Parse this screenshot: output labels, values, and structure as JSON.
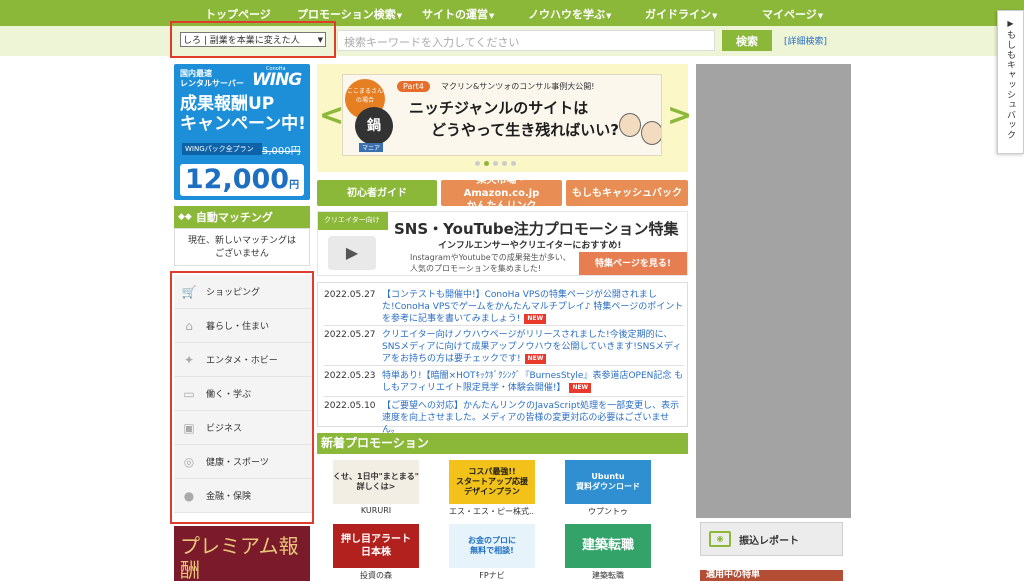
{
  "nav": {
    "items": [
      "トップページ",
      "プロモーション検索",
      "サイトの運営",
      "ノウハウを学ぶ",
      "ガイドライン",
      "マイページ"
    ],
    "dropdown_flags": [
      false,
      true,
      true,
      true,
      true,
      true
    ]
  },
  "search": {
    "site_select": "しろ | 副業を本業に変えた人",
    "placeholder": "検索キーワードを入力してください",
    "button": "検索",
    "advanced": "[詳細検索]"
  },
  "side_tab": {
    "label": "もしもキャッシュバック"
  },
  "left": {
    "wing": {
      "line1": "国内最速",
      "line2": "レンタルサーバー",
      "brand_small": "ConoHa",
      "brand": "WING",
      "head1": "成果報酬UP",
      "head2": "キャンペーン中!",
      "plan": "WINGパック全プラン",
      "old_price": "5,000円",
      "price": "12,000",
      "price_unit": "円"
    },
    "auto_matching": {
      "title": "自動マッチング",
      "body1": "現在、新しいマッチングは",
      "body2": "ございません"
    },
    "categories": [
      {
        "label": "ショッピング",
        "icon": "cart-icon"
      },
      {
        "label": "暮らし・住まい",
        "icon": "house-icon"
      },
      {
        "label": "エンタメ・ホビー",
        "icon": "game-icon"
      },
      {
        "label": "働く・学ぶ",
        "icon": "desk-icon"
      },
      {
        "label": "ビジネス",
        "icon": "briefcase-icon"
      },
      {
        "label": "健康・スポーツ",
        "icon": "pin-icon"
      },
      {
        "label": "金融・保険",
        "icon": "piggybank-icon"
      }
    ],
    "premium": "プレミアム報酬"
  },
  "carousel": {
    "badge": "ここまるさんの場合",
    "part": "Part4",
    "sub": "マクリン&サンツォのコンサル事例大公開!",
    "title1": "ニッチジャンルのサイトは",
    "title2": "どうやって生き残ればいい?",
    "pot_label": "鍋",
    "pot_sub": "マニア"
  },
  "guide_buttons": [
    {
      "label": "初心者ガイド",
      "color": "#8cb83a"
    },
    {
      "label1": "楽天市場・Amazon.co.jp",
      "label2": "かんたんリンク",
      "color": "#e88e55"
    },
    {
      "label": "もしもキャッシュバック",
      "color": "#e88e55"
    }
  ],
  "sns_banner": {
    "tag": "クリエイター向け",
    "title": "SNS・YouTube注力プロモーション特集",
    "sub": "インフルエンサーやクリエイターにおすすめ!",
    "desc1": "InstagramやYoutubeでの成果発生が多い、",
    "desc2": "人気のプロモーションを集めました!",
    "cta": "特集ページを見る!"
  },
  "news": [
    {
      "date": "2022.05.27",
      "text": "【コンテストも開催中!】ConoHa VPSの特集ページが公開されました!ConoHa VPSでゲームをかんたんマルチプレイ♪ 特集ページのポイントを参考に記事を書いてみましょう!",
      "new": "NEW"
    },
    {
      "date": "2022.05.27",
      "text": "クリエイター向けノウハウページがリリースされました!今後定期的に、SNSメディアに向けて成果アップノウハウを公開していきます!SNSメディアをお持ちの方は要チェックです!",
      "new": "NEW"
    },
    {
      "date": "2022.05.23",
      "text": "特単あり!【暗闇×HOTｷｯｸﾎﾞｸｼﾝｸﾞ『BurnesStyle』表参道店OPEN記念 もしもアフィリエイト限定見学・体験会開催!】",
      "new": "NEW"
    },
    {
      "date": "2022.05.10",
      "text": "【ご要望への対応】かんたんリンクのJavaScript処理を一部変更し、表示速度を向上させました。メディアの皆様の変更対応の必要はございません。",
      "new": ""
    }
  ],
  "new_promotions": {
    "title": "新着プロモーション",
    "items": [
      {
        "label": "KURURI",
        "img_text": "くせ、1日中\"まとまる\"\n詳しくは>",
        "bg": "#f3eee4",
        "fg": "#333"
      },
      {
        "label": "エス・エス・ピー株式...",
        "img_text": "コスパ最強!!\nスタートアップ応援\nデザインプラン",
        "bg": "#f2c21a",
        "fg": "#1a1a1a"
      },
      {
        "label": "ウプントゥ",
        "img_text": "Ubuntu\n資料ダウンロード",
        "bg": "#2f8fd1",
        "fg": "#fff"
      },
      {
        "label": "投資の森",
        "img_text": "押し目アラート\n日本株",
        "bg": "#b3211e",
        "fg": "#fff"
      },
      {
        "label": "FPナビ",
        "img_text": "お金のプロに\n無料で相談!",
        "bg": "#e7f3fb",
        "fg": "#1d6fc2"
      },
      {
        "label": "建築転職",
        "img_text": "建築転職",
        "bg": "#33a36a",
        "fg": "#fff"
      }
    ]
  },
  "right": {
    "furikomi": "振込レポート",
    "tekiyo": "適用中の特単"
  }
}
